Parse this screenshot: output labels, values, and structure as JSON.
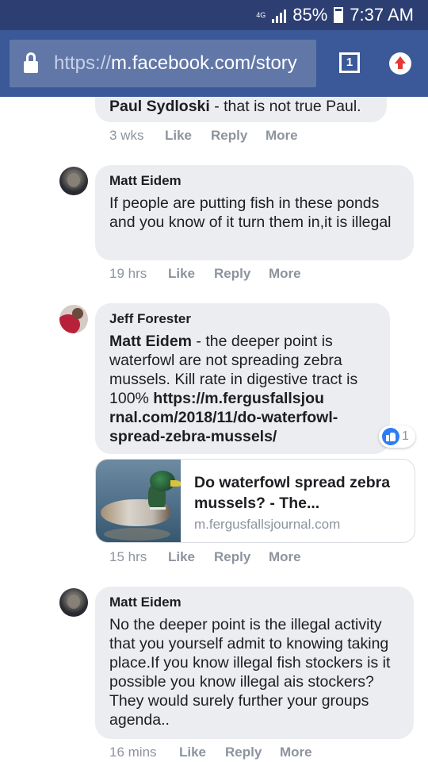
{
  "status_bar": {
    "network": "4G",
    "battery": "85%",
    "time": "7:37 AM"
  },
  "browser": {
    "url_scheme": "https://",
    "url_rest": "m.facebook.com/story",
    "tab_count": "1"
  },
  "comments": [
    {
      "name": "",
      "text_bold": "Paul Sydloski",
      "text": " - that is not true Paul.",
      "time": "3 wks",
      "like": "Like",
      "reply": "Reply",
      "more": "More"
    },
    {
      "name": "Matt Eidem",
      "text": "If people are putting fish in these ponds and you know of it turn them in,it is illegal",
      "time": "19 hrs",
      "like": "Like",
      "reply": "Reply",
      "more": "More"
    },
    {
      "name": "Jeff Forester",
      "text_bold": "Matt Eidem",
      "text": " - the deeper point is waterfowl are not spreading zebra mussels. Kill rate in digestive tract is 100% ",
      "link": "https://m.fergusfallsjou rnal.com/2018/11/do-waterfowl- spread-zebra-mussels/",
      "reaction_count": "1",
      "time": "15 hrs",
      "like": "Like",
      "reply": "Reply",
      "more": "More"
    },
    {
      "name": "Matt Eidem",
      "text": "No the deeper point is the illegal activity that you yourself admit to knowing taking place.If you know illegal fish stockers is it possible you know illegal ais stockers?They would surely further your groups agenda..",
      "time": "16 mins",
      "like": "Like",
      "reply": "Reply",
      "more": "More"
    }
  ],
  "link_preview": {
    "title": "Do waterfowl spread zebra mussels? - The...",
    "domain": "m.fergusfallsjournal.com"
  },
  "colors": {
    "status_bar": "#2c3e72",
    "url_bar": "#3b5998",
    "bubble": "#ebedf0",
    "meta_text": "#8d949e",
    "like_blue": "#2d7cf6"
  }
}
